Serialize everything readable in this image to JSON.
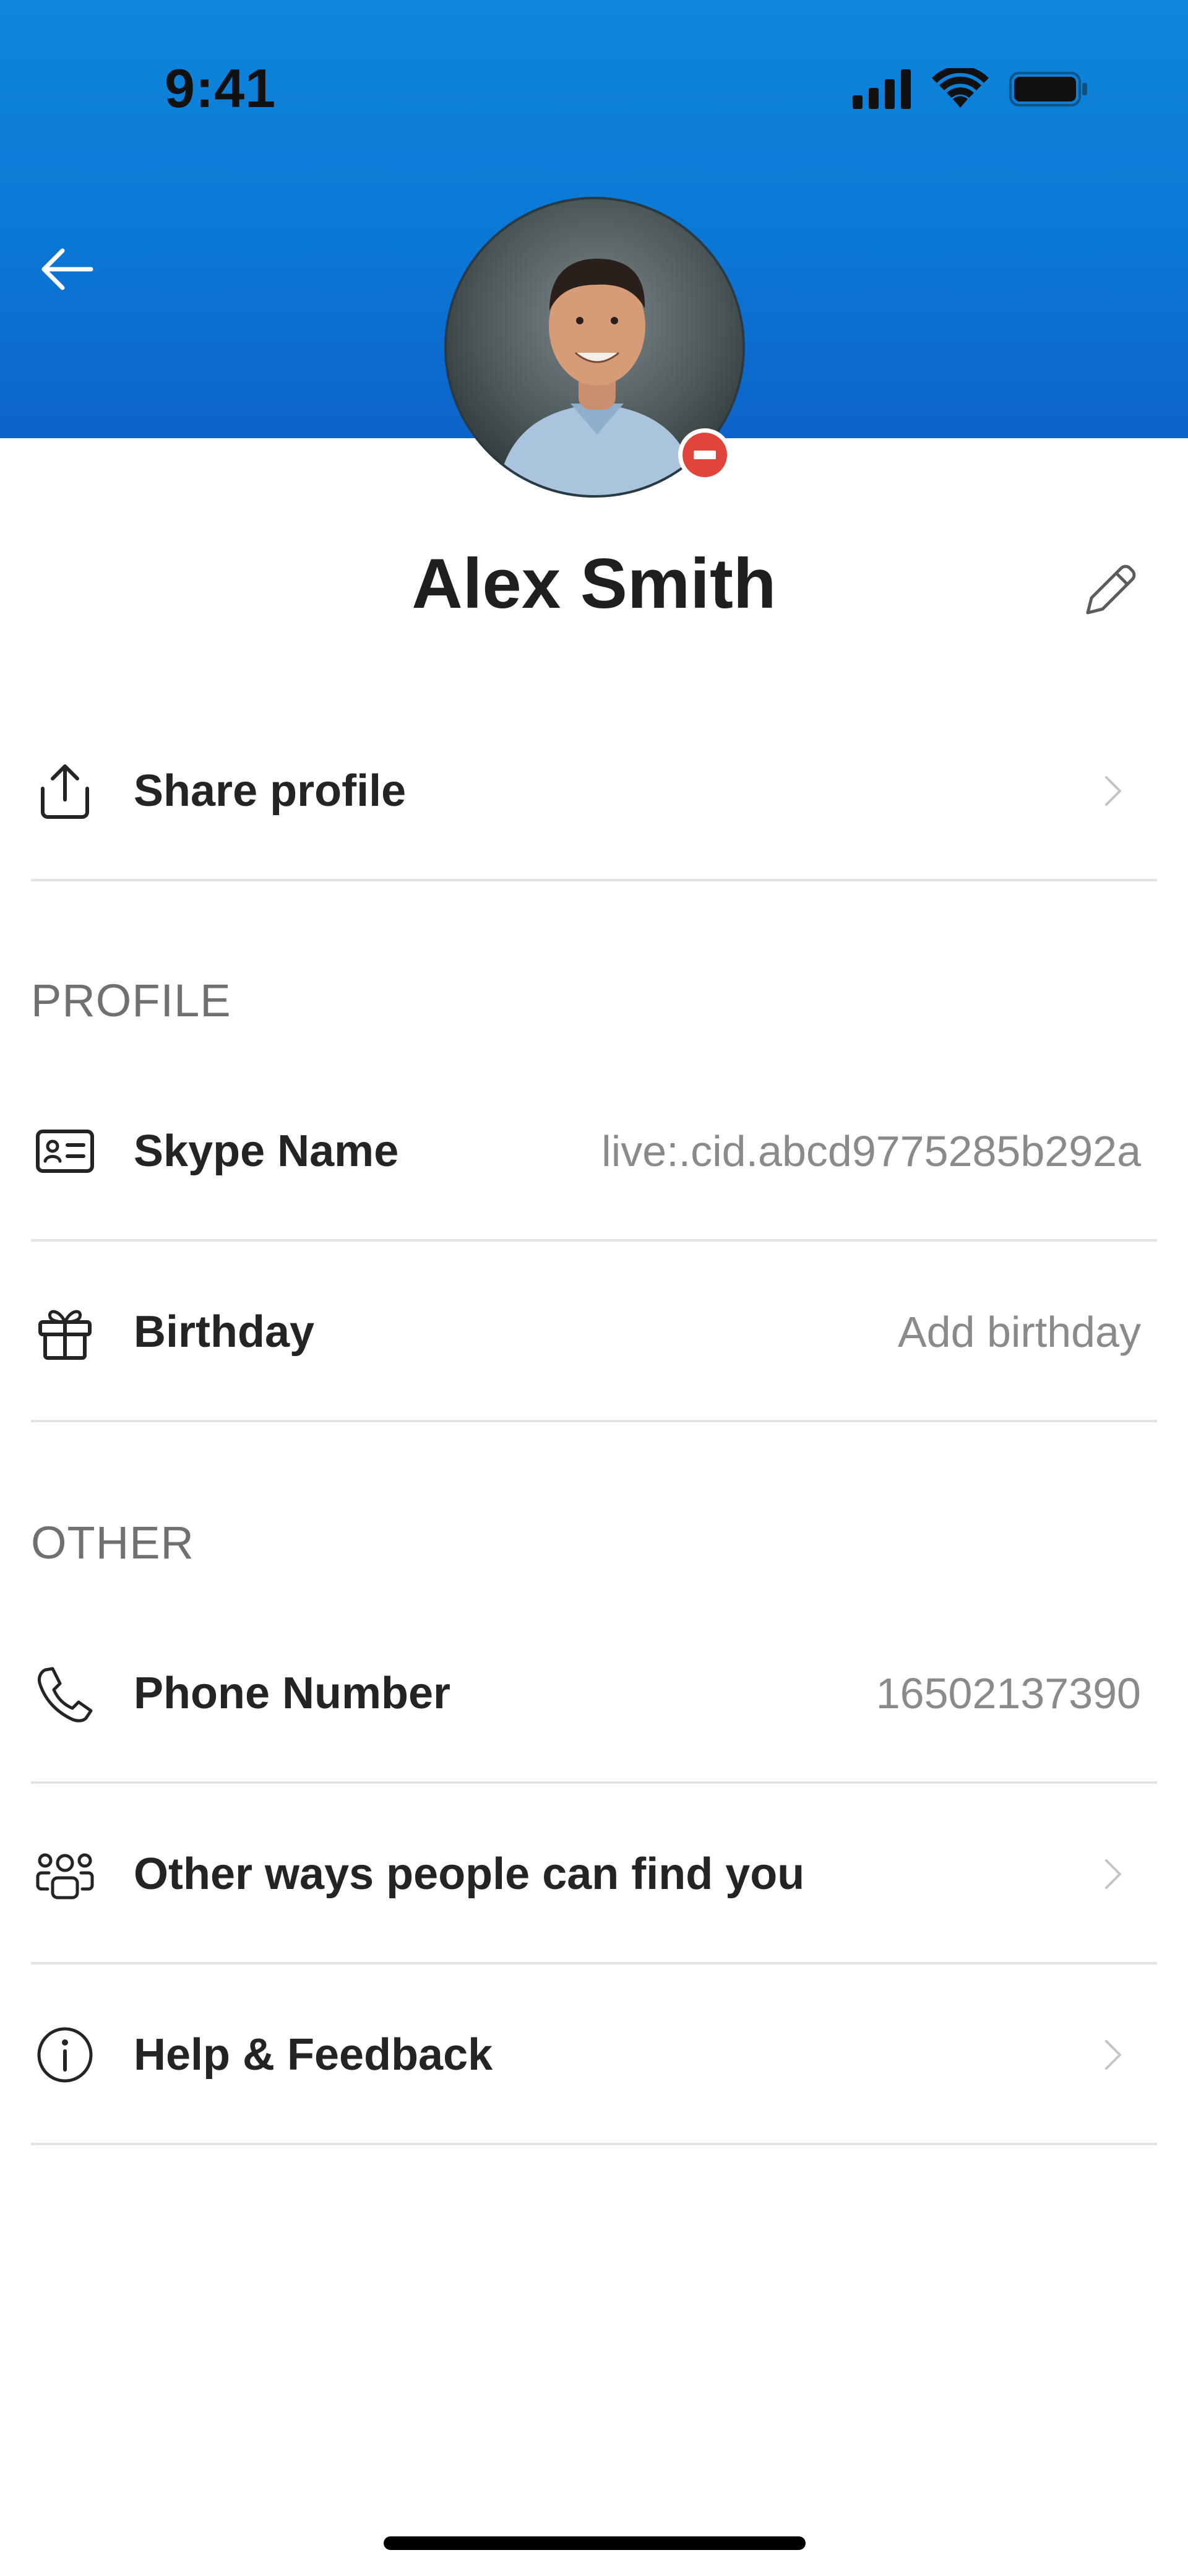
{
  "status_bar": {
    "time": "9:41",
    "icons": [
      "signal-icon",
      "wifi-icon",
      "battery-icon"
    ]
  },
  "header": {
    "back_icon": "arrow-left-icon",
    "gradient_colors": [
      "#0f86db",
      "#0d63c9"
    ]
  },
  "profile": {
    "name": "Alex Smith",
    "avatar": "avatar-photo",
    "presence_status_color": "#e0443a",
    "edit_icon": "pencil-icon"
  },
  "share_row": {
    "label": "Share profile",
    "icon": "share-icon"
  },
  "sections": {
    "profile_header": "PROFILE",
    "other_header": "OTHER"
  },
  "profile_rows": [
    {
      "label": "Skype Name",
      "value": "live:.cid.abcd9775285b292a",
      "icon": "contact-card-icon"
    },
    {
      "label": "Birthday",
      "value": "Add birthday",
      "icon": "gift-icon"
    }
  ],
  "other_rows": [
    {
      "label": "Phone Number",
      "value": "16502137390",
      "icon": "phone-icon"
    },
    {
      "label": "Other ways people can find you",
      "icon": "people-icon"
    },
    {
      "label": "Help & Feedback",
      "icon": "info-icon"
    }
  ],
  "colors": {
    "accent": "#0b78d6",
    "text_primary": "#242424",
    "text_secondary": "#8a8a8a",
    "section_header": "#707070",
    "divider": "#e3e3e3"
  }
}
